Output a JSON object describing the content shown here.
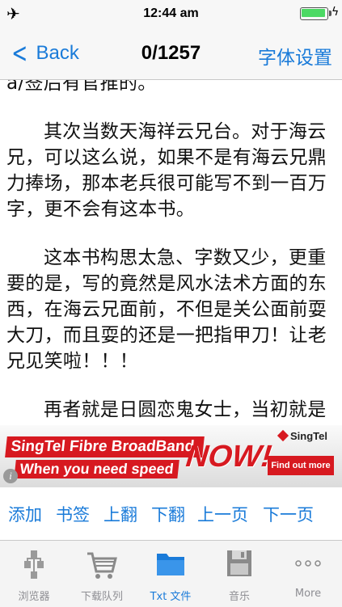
{
  "status_bar": {
    "time": "12:44 am"
  },
  "nav": {
    "back_label": "Back",
    "page_counter": "0/1257",
    "settings_label": "字体设置"
  },
  "content": {
    "paragraphs": [
      "a/签后有官推的。",
      "其次当数天海祥云兄台。对于海云兄，可以这么说，如果不是有海云兄鼎力捧场，那本老兵很可能写不到一百万字，更不会有这本书。",
      "这本书构思太急、字数又少，更重要的是，写的竟然是风水法术方面的东西，在海云兄面前，不但是关公面前耍大刀，而且耍的还是一把指甲刀！让老兄见笑啦！！！",
      "再者就是日圆恋鬼女士，当初就是老"
    ]
  },
  "ad": {
    "line1": "SingTel Fibre BroadBand.",
    "line2": "When you need speed",
    "now": "NOW!",
    "brand": "SingTel",
    "cta": "Find out more",
    "info": "i"
  },
  "actions": [
    "添加",
    "书签",
    "上翻",
    "下翻",
    "上一页",
    "下一页"
  ],
  "tabs": [
    {
      "label": "浏览器",
      "icon": "sitemap-icon"
    },
    {
      "label": "下载队列",
      "icon": "cart-icon"
    },
    {
      "label": "Txt 文件",
      "icon": "folder-icon",
      "active": true
    },
    {
      "label": "音乐",
      "icon": "floppy-icon"
    },
    {
      "label": "More",
      "icon": "more-dots-icon"
    }
  ],
  "colors": {
    "accent": "#1a7bd9",
    "ad_red": "#d71920",
    "battery": "#4cd964"
  }
}
